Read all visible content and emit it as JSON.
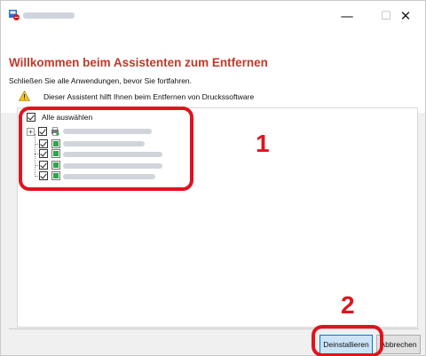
{
  "window": {
    "close_glyph": "✕",
    "minimize_glyph": "—",
    "maximize_glyph": "☐"
  },
  "header": {
    "heading": "Willkommen beim Assistenten zum Entfernen",
    "subtext": "Schließen Sie alle Anwendungen, bevor Sie fortfahren.",
    "warning_text": "Dieser Assistent hilft Ihnen beim Entfernen von Druckssoftware"
  },
  "tree": {
    "select_all_label": "Alle auswählen",
    "expander_glyph": "+"
  },
  "callouts": {
    "step1": "1",
    "step2": "2"
  },
  "buttons": {
    "uninstall": "Deinstallieren",
    "cancel": "Abbrechen"
  },
  "colors": {
    "heading": "#c0392b",
    "callout": "#e0141e",
    "primary_button_bg": "#cce4f7",
    "primary_button_border": "#0078d7"
  }
}
